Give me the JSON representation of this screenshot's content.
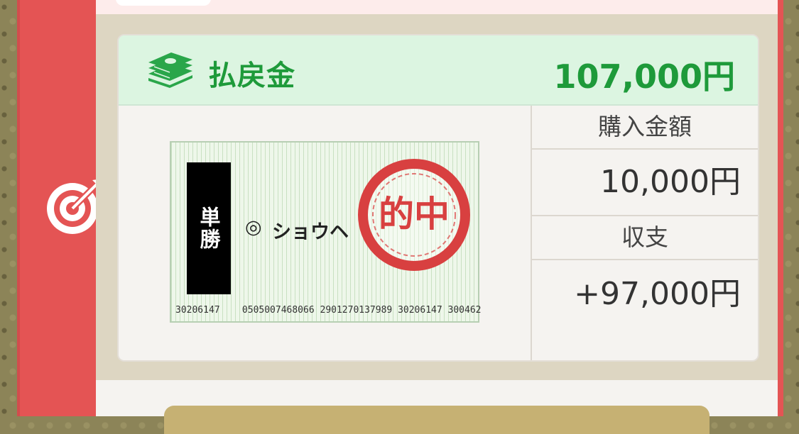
{
  "payout": {
    "label": "払戻金",
    "amount": "107,000円",
    "icon": "money-stack-icon",
    "color": "#1e9a3a"
  },
  "ticket": {
    "bet_type": "単勝",
    "mark": "◎",
    "horse": "ショウヘ",
    "stamp_text": "的中",
    "code": "30206147    0505007468066 2901270137989 30206147 300462"
  },
  "summary": {
    "purchase_label": "購入金額",
    "purchase_value": "10,000円",
    "balance_label": "収支",
    "balance_value": "+97,000円"
  },
  "sidebar": {
    "icon": "target-icon",
    "color": "#e45454"
  }
}
